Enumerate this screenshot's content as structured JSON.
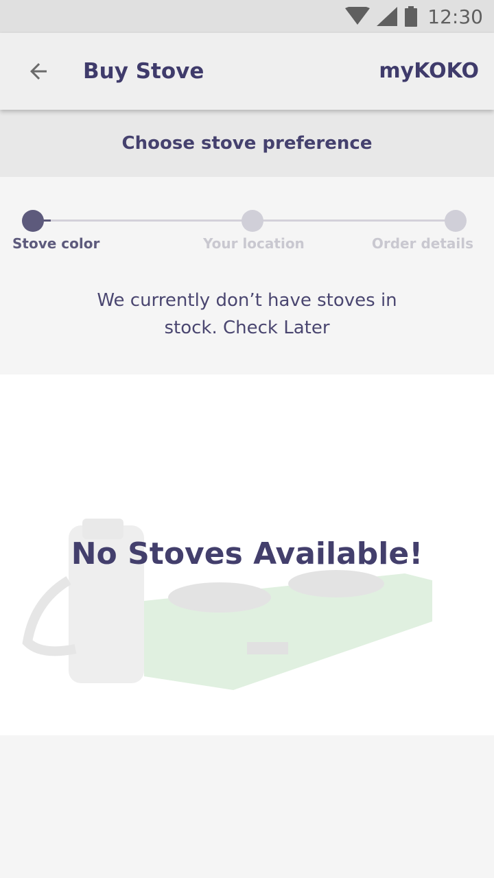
{
  "status_bar": {
    "time": "12:30",
    "icons": [
      "wifi-icon",
      "cell-signal-icon",
      "battery-icon"
    ]
  },
  "app_bar": {
    "back_icon": "arrow-left-icon",
    "title": "Buy Stove",
    "brand": "myKOKO"
  },
  "subheader": {
    "text": "Choose stove preference"
  },
  "stepper": {
    "steps": [
      {
        "label": "Stove color",
        "state": "active"
      },
      {
        "label": "Your location",
        "state": "inactive"
      },
      {
        "label": "Order details",
        "state": "inactive"
      }
    ]
  },
  "message": {
    "line1": "We currently don’t have stoves in",
    "line2": "stock. Check Later"
  },
  "empty_state": {
    "title": "No Stoves Available!",
    "illustration": "stove-illustration"
  },
  "colors": {
    "primary": "#433f6c",
    "step_active": "#5d5a7c",
    "step_inactive": "#d0cfd8",
    "background": "#f5f5f5",
    "card": "#ffffff"
  }
}
